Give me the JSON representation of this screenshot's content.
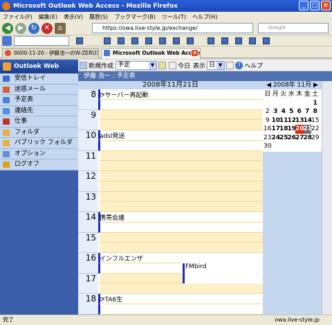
{
  "window": {
    "title": "Microsoft Outlook Web Access - Mozilla Firefox"
  },
  "menu": [
    "ファイル(F)",
    "編集(E)",
    "表示(V)",
    "履歴(S)",
    "ブックマーク(B)",
    "ツール(T)",
    "ヘルプ(H)"
  ],
  "navbar": {
    "url": "https://owa.live-style.jp/exchange/",
    "search_placeholder": "Google"
  },
  "tabs": [
    {
      "label": "0000-11-20 - 伊藤浩一のW-ZERO3...",
      "active": false
    },
    {
      "label": "Microsoft Outlook Web Access",
      "active": true
    }
  ],
  "sidebar": {
    "logo": "Outlook Web Access",
    "items": [
      {
        "label": "受信トレイ",
        "icon": "inbox-icon",
        "color": "#3a6ed0"
      },
      {
        "label": "迷惑メール",
        "icon": "junk-mail-icon",
        "color": "#d86030"
      },
      {
        "label": "予定表",
        "icon": "calendar-icon",
        "color": "#4a80d8"
      },
      {
        "label": "連絡先",
        "icon": "contacts-icon",
        "color": "#5090e0"
      },
      {
        "label": "仕事",
        "icon": "tasks-icon",
        "color": "#c03030"
      },
      {
        "label": "フォルダ",
        "icon": "folder-icon",
        "color": "#e8b040"
      },
      {
        "label": "パブリック フォルダ",
        "icon": "public-folder-icon",
        "color": "#e8b040"
      },
      {
        "label": "オプション",
        "icon": "options-icon",
        "color": "#6090d0"
      },
      {
        "label": "ログオフ",
        "icon": "logoff-icon",
        "color": "#e0a020"
      }
    ]
  },
  "toolbar": {
    "new_label": "新規作成",
    "new_type": "予定",
    "today_label": "今日",
    "view_label": "表示",
    "view_value": "日",
    "help_label": "ヘルプ"
  },
  "user": {
    "name": "伊藤 浩一 : 予定表"
  },
  "day": {
    "date_label": "2008年11月21日"
  },
  "hours": [
    "8",
    "9",
    "10",
    "11",
    "12",
    "13",
    "14",
    "15",
    "16",
    "17",
    "18"
  ],
  "events": {
    "ev8": "サーバー再起動",
    "ev10": "adsl発送",
    "ev14": "携帯会議",
    "ev16": "インフルエンザ",
    "ev16b": "FMbird",
    "ev18": "TA6生"
  },
  "minical": {
    "month_label": "2008年 11月",
    "weekdays": [
      "日",
      "月",
      "火",
      "水",
      "木",
      "金",
      "土"
    ],
    "weeks": [
      [
        "",
        "",
        "",
        "",
        "",
        "",
        "1"
      ],
      [
        "2",
        "3",
        "4",
        "5",
        "6",
        "7",
        "8"
      ],
      [
        "9",
        "10",
        "11",
        "12",
        "13",
        "14",
        "15"
      ],
      [
        "16",
        "17",
        "18",
        "19",
        "20",
        "21",
        "22"
      ],
      [
        "23",
        "24",
        "25",
        "26",
        "27",
        "28",
        "29"
      ],
      [
        "30",
        "",
        "",
        "",
        "",
        "",
        ""
      ]
    ],
    "selected_day": "20",
    "today_day": "21"
  },
  "status": {
    "left": "完了",
    "right": "owa.live-style.jp"
  }
}
